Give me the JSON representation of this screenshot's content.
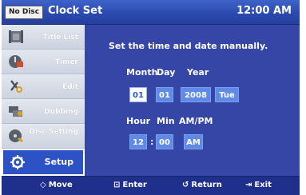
{
  "header": {
    "nodisc": "No Disc",
    "title": "Clock Set",
    "time": "12:00 AM"
  },
  "sidebar": {
    "items": [
      {
        "label": "Title List",
        "icon": "title-list-icon"
      },
      {
        "label": "Timer",
        "icon": "timer-icon"
      },
      {
        "label": "Edit",
        "icon": "scissors-icon"
      },
      {
        "label": "Dubbing",
        "icon": "dubbing-icon"
      },
      {
        "label": "Disc Setting",
        "icon": "disc-icon"
      },
      {
        "label": "Setup",
        "icon": "gear-icon",
        "active": true
      }
    ]
  },
  "main": {
    "instruction": "Set the time and date manually.",
    "date": {
      "month_label": "Month",
      "day_label": "Day",
      "year_label": "Year",
      "month": "01",
      "day": "01",
      "year": "2008",
      "weekday": "Tue"
    },
    "time": {
      "hour_label": "Hour",
      "min_label": "Min",
      "ampm_label": "AM/PM",
      "hour": "12",
      "separator": ":",
      "min": "00",
      "ampm": "AM"
    }
  },
  "footer": {
    "move": "Move",
    "enter": "Enter",
    "return": "Return",
    "exit": "Exit",
    "move_icon": "◇",
    "enter_icon": "⊡",
    "return_icon": "↺",
    "exit_icon": "⇥"
  },
  "colors": {
    "accent": "#2c52c5",
    "panel": "#3546a6",
    "field": "#5f8be6"
  }
}
